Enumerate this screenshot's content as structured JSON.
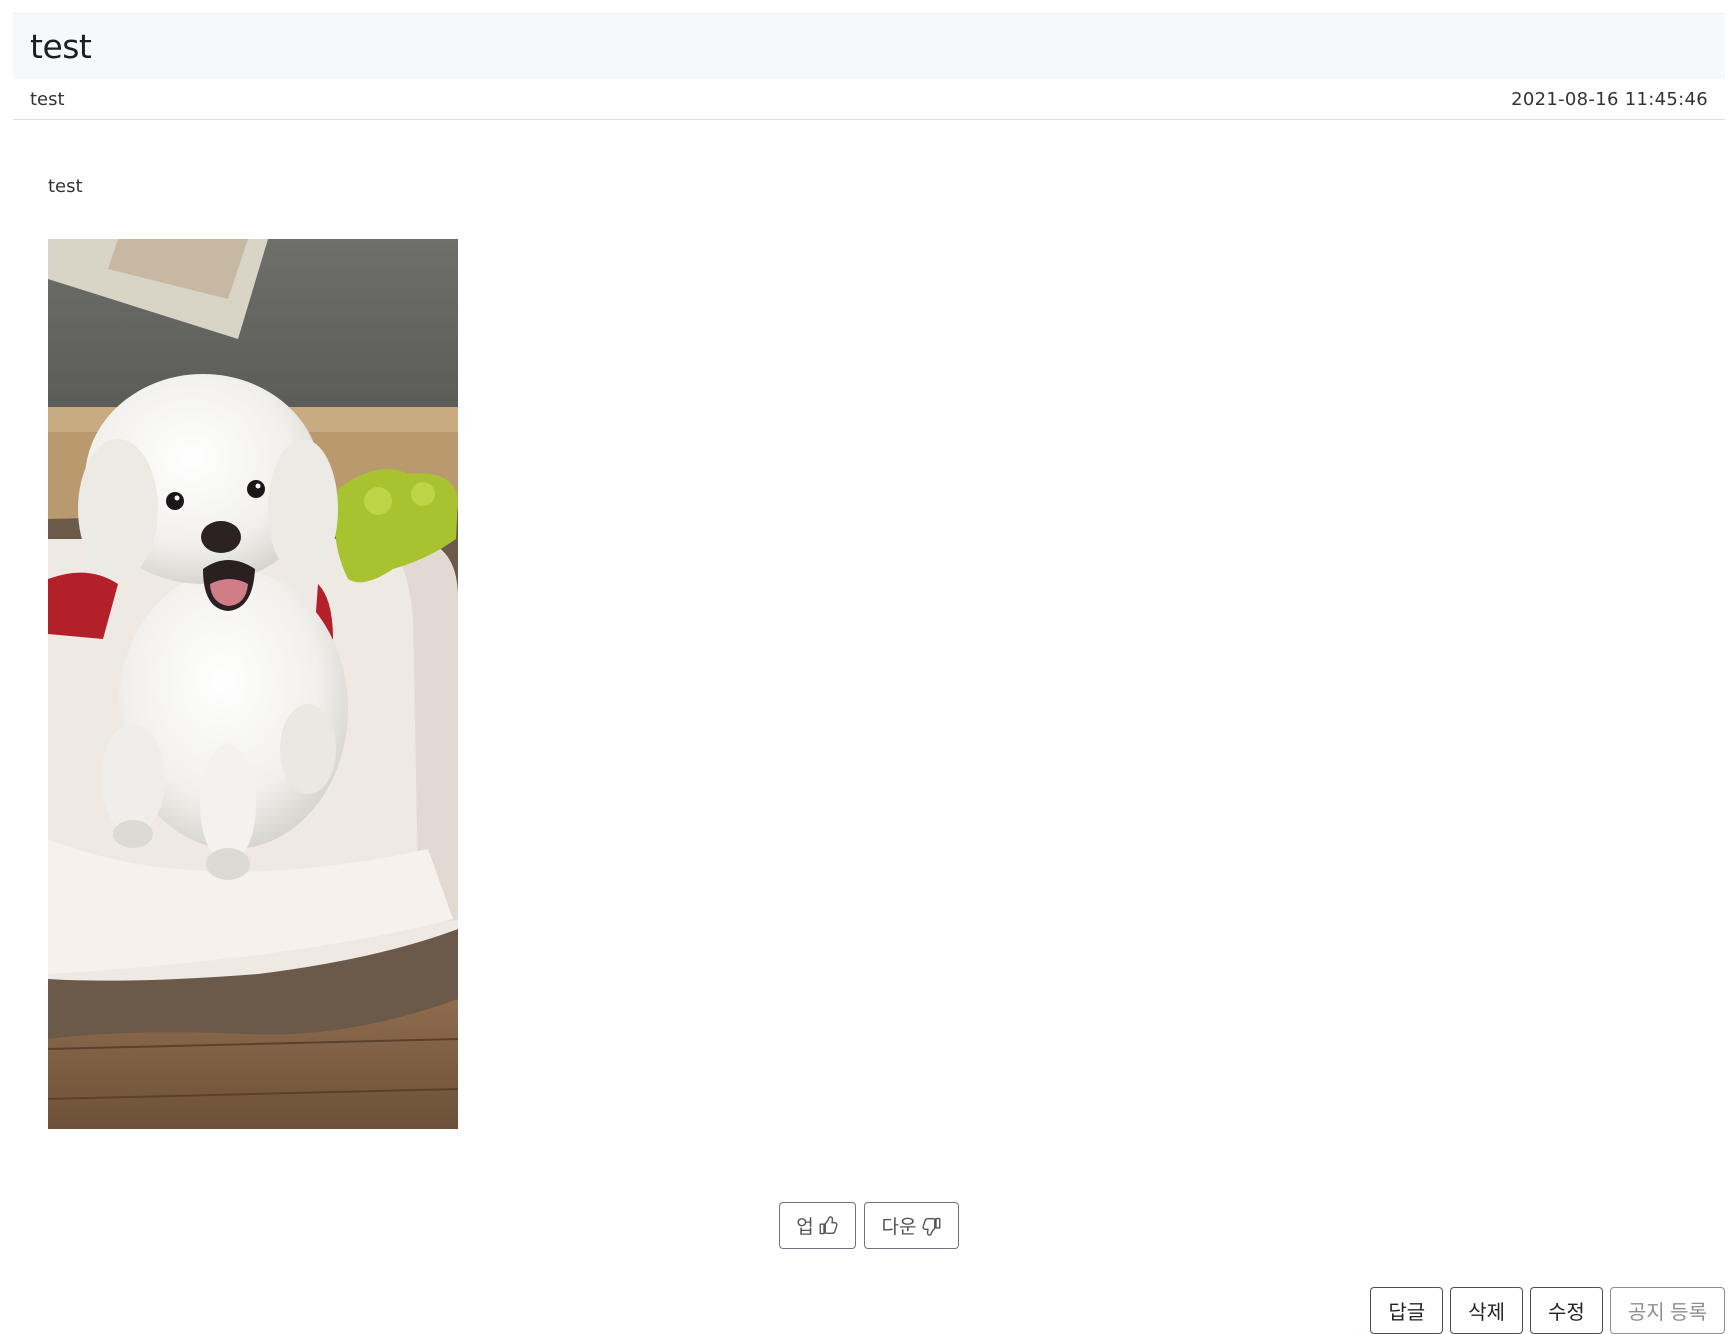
{
  "post": {
    "title": "test",
    "author": "test",
    "date": "2021-08-16 11:45:46",
    "body": "test"
  },
  "image": {
    "subject": "white fluffy dog sitting on a pet bed"
  },
  "vote": {
    "up_label": "업",
    "up_icon": "thumbs-up-icon",
    "down_label": "다운",
    "down_icon": "thumbs-down-icon"
  },
  "actions": {
    "reply": "답글",
    "delete": "삭제",
    "edit": "수정",
    "notice": "공지 등록"
  },
  "colors": {
    "header_bg": "#f7f8f9",
    "border": "#6c757d",
    "text": "#212529",
    "muted": "#8a8f94"
  }
}
